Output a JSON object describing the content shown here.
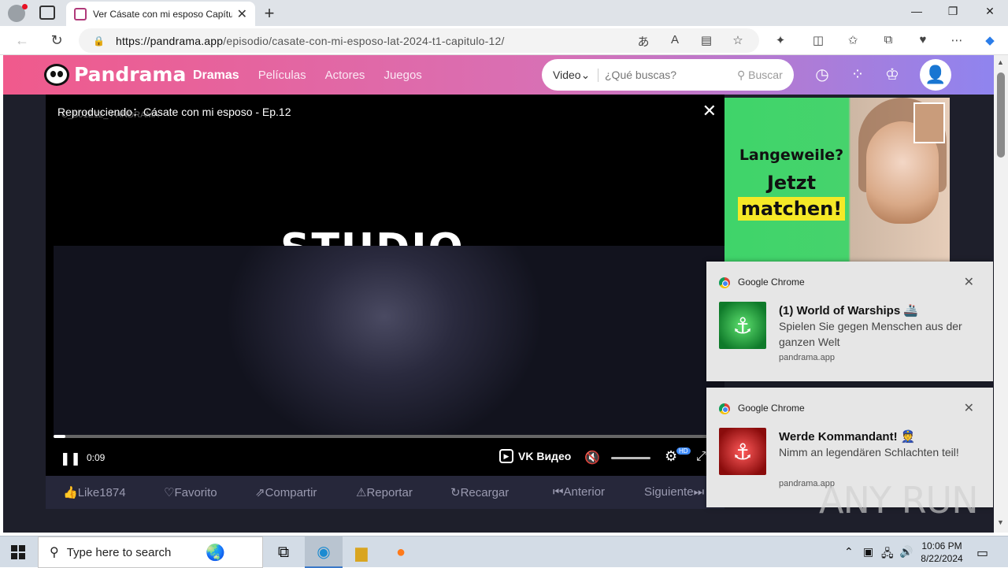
{
  "browser": {
    "tab_title": "Ver Cásate con mi esposo Capítulo",
    "url_host": "https://pandrama.app",
    "url_path": "/episodio/casate-con-mi-esposo-lat-2024-t1-capitulo-12/",
    "new_tab_label": "+"
  },
  "site": {
    "logo": "Pandrama",
    "nav": [
      "Dramas",
      "Películas",
      "Actores",
      "Juegos"
    ],
    "search": {
      "type_label": "Video",
      "placeholder": "¿Qué buscas?",
      "button_label": "Buscar"
    }
  },
  "player": {
    "now_playing": "Reproduciendo：Cásate con mi esposo - Ep.12",
    "watermark": "C_S01E12_ PANDRAMA",
    "overlay_text": "STUDIO",
    "time": "0:09",
    "brand": "VK Видео",
    "hd_badge": "HD",
    "progress": 0.018
  },
  "actions": [
    "Like1874",
    "Favorito",
    "Compartir",
    "Reportar",
    "Recargar",
    "Anterior",
    "Siguiente"
  ],
  "ad": {
    "line1": "Langeweile?",
    "line2": "Jetzt",
    "line3": "matchen!"
  },
  "notifications": [
    {
      "app": "Google Chrome",
      "title": "(1) World of Warships 🚢",
      "body": "Spielen Sie gegen Menschen aus der ganzen Welt",
      "source": "pandrama.app",
      "color": "#1e9b3c"
    },
    {
      "app": "Google Chrome",
      "title": "Werde Kommandant! 👮",
      "body": "Nimm an legendären Schlachten teil!",
      "source": "pandrama.app",
      "color": "#c81e1e"
    }
  ],
  "watermark_logo": "ANY RUN",
  "taskbar": {
    "search_placeholder": "Type here to search",
    "time": "10:06 PM",
    "date": "8/22/2024"
  }
}
